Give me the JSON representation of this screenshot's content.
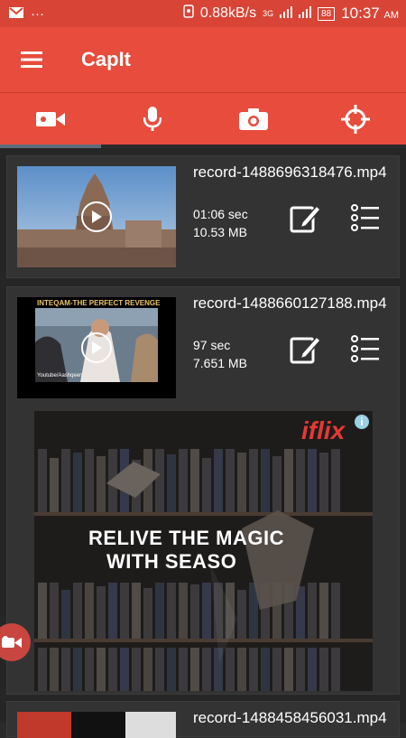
{
  "status": {
    "net_speed": "0.88kB/s",
    "net_type": "3G",
    "battery": "88",
    "time": "10:37",
    "ampm": "AM",
    "more": "···"
  },
  "app": {
    "title": "CapIt"
  },
  "tabs": [
    {
      "icon": "video-camera-icon"
    },
    {
      "icon": "microphone-icon"
    },
    {
      "icon": "camera-icon"
    },
    {
      "icon": "crosshair-icon"
    }
  ],
  "recordings": [
    {
      "filename": "record-1488696318476.mp4",
      "duration": "01:06 sec",
      "size": "10.53 MB"
    },
    {
      "filename": "record-1488660127188.mp4",
      "duration": "97 sec",
      "size": "7.651 MB",
      "thumb_caption": "INTEQAM-THE PERFECT REVENGE",
      "thumb_sub": "Youtube/Aashqeen"
    },
    {
      "filename": "record-1488458456031.mp4"
    }
  ],
  "ad": {
    "brand": "iflix",
    "headline_line1": "RELIVE THE MAGIC",
    "headline_line2": "WITH SEASO",
    "info": "i"
  },
  "colors": {
    "primary": "#e74c3c",
    "status": "#d84536",
    "card": "#333333"
  }
}
